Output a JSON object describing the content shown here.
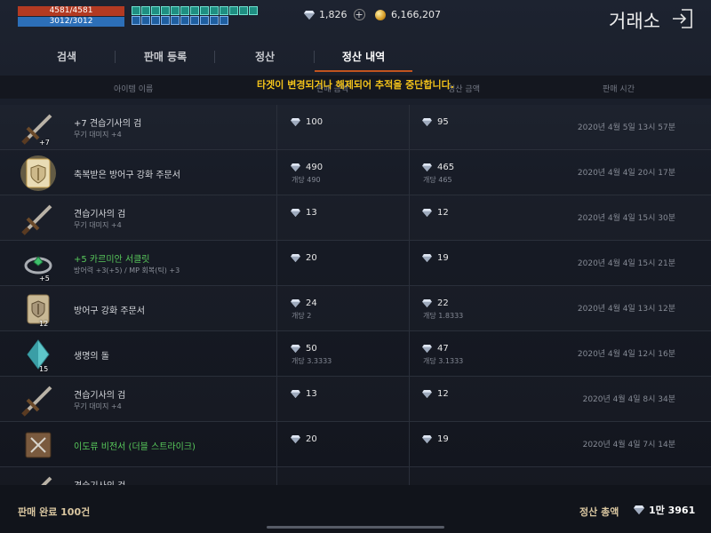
{
  "status": {
    "hp": "4581/4581",
    "mp": "3012/3012"
  },
  "currency": {
    "diamonds": "1,826",
    "add": "+",
    "gold": "6,166,207"
  },
  "header": {
    "title": "거래소"
  },
  "tabs": [
    {
      "label": "검색"
    },
    {
      "label": "판매 등록"
    },
    {
      "label": "정산"
    },
    {
      "label": "정산 내역"
    }
  ],
  "columns": {
    "name": "아이템 이름",
    "price": "판매 금액",
    "settle": "정산 금액",
    "time": "판매 시간"
  },
  "notice": "타겟이 변경되거나 해제되어 추적을 중단합니다.",
  "rows": [
    {
      "name": "+7 견습기사의 검",
      "sub": "무기 대미지 +4",
      "count": "+7",
      "price": "100",
      "price_sub": "",
      "settle": "95",
      "settle_sub": "",
      "time": "2020년 4월 5일 13시 57분",
      "green": false,
      "icon": "sword-icon"
    },
    {
      "name": "축복받은 방어구 강화 주문서",
      "sub": "",
      "count": "",
      "price": "490",
      "price_sub": "개당 490",
      "settle": "465",
      "settle_sub": "개당 465",
      "time": "2020년 4월 4일 20시 17분",
      "green": false,
      "icon": "blessed-scroll-icon"
    },
    {
      "name": "견습기사의 검",
      "sub": "무기 대미지 +4",
      "count": "",
      "price": "13",
      "price_sub": "",
      "settle": "12",
      "settle_sub": "",
      "time": "2020년 4월 4일 15시 30분",
      "green": false,
      "icon": "sword-icon"
    },
    {
      "name": "+5 카르미안 서클릿",
      "sub": "방어력 +3(+5) / MP 회복(틱) +3",
      "count": "+5",
      "price": "20",
      "price_sub": "",
      "settle": "19",
      "settle_sub": "",
      "time": "2020년 4월 4일 15시 21분",
      "green": true,
      "icon": "circlet-icon"
    },
    {
      "name": "방어구 강화 주문서",
      "sub": "",
      "count": "12",
      "price": "24",
      "price_sub": "개당 2",
      "settle": "22",
      "settle_sub": "개당 1.8333",
      "time": "2020년 4월 4일 13시 12분",
      "green": false,
      "icon": "scroll-icon"
    },
    {
      "name": "생명의 돌",
      "sub": "",
      "count": "15",
      "price": "50",
      "price_sub": "개당 3.3333",
      "settle": "47",
      "settle_sub": "개당 3.1333",
      "time": "2020년 4월 4일 12시 16분",
      "green": false,
      "icon": "life-stone-icon"
    },
    {
      "name": "견습기사의 검",
      "sub": "무기 대미지 +4",
      "count": "",
      "price": "13",
      "price_sub": "",
      "settle": "12",
      "settle_sub": "",
      "time": "2020년 4월 4일 8시 34분",
      "green": false,
      "icon": "sword-icon"
    },
    {
      "name": "이도류 비전서 (더블 스트라이크)",
      "sub": "",
      "count": "",
      "price": "20",
      "price_sub": "",
      "settle": "19",
      "settle_sub": "",
      "time": "2020년 4월 4일 7시 14분",
      "green": true,
      "icon": "spellbook-icon"
    },
    {
      "name": "견습기사의 검",
      "sub": "",
      "count": "",
      "price": "",
      "price_sub": "",
      "settle": "",
      "settle_sub": "",
      "time": "",
      "green": false,
      "icon": "sword-icon"
    }
  ],
  "footer": {
    "completed": "판매 완료 100건",
    "total_label": "정산 총액",
    "total": "1만 3961"
  }
}
